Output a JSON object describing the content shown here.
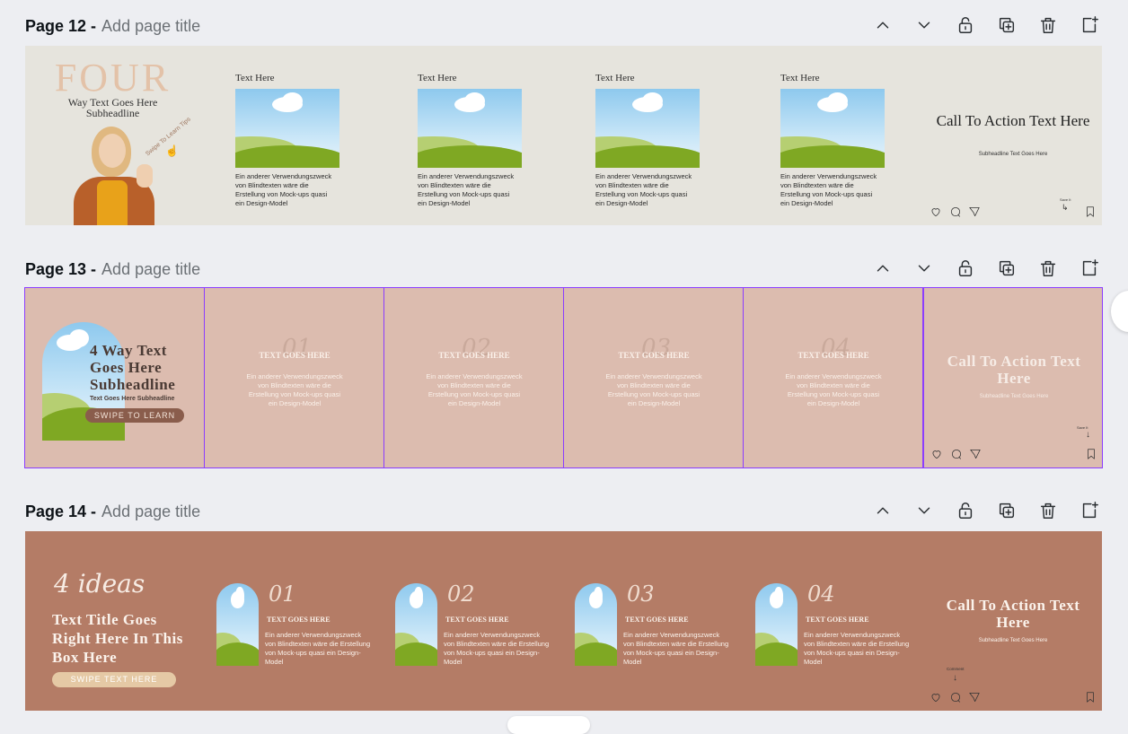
{
  "pages": [
    {
      "number_label": "Page 12 -",
      "title_placeholder": "Add page title"
    },
    {
      "number_label": "Page 13 -",
      "title_placeholder": "Add page title"
    },
    {
      "number_label": "Page 14 -",
      "title_placeholder": "Add page title"
    }
  ],
  "toolbar_icons": [
    "chevron-up-icon",
    "chevron-down-icon",
    "lock-icon",
    "duplicate-icon",
    "trash-icon",
    "add-page-icon"
  ],
  "page12": {
    "hero_big": "FOUR",
    "hero_sub": "Way Text Goes Here Subheadline",
    "hero_curve": "Swipe To Learn Tips",
    "cards": [
      {
        "title": "Text Here",
        "body": "Ein anderer Verwendungszweck von Blindtexten wäre die Erstellung von Mock-ups quasi ein Design-Model"
      },
      {
        "title": "Text Here",
        "body": "Ein anderer Verwendungszweck von Blindtexten wäre die Erstellung von Mock-ups quasi ein Design-Model"
      },
      {
        "title": "Text Here",
        "body": "Ein anderer Verwendungszweck von Blindtexten wäre die Erstellung von Mock-ups quasi ein Design-Model"
      },
      {
        "title": "Text Here",
        "body": "Ein anderer Verwendungszweck von Blindtexten wäre die Erstellung von Mock-ups quasi ein Design-Model"
      }
    ],
    "cta": "Call To Action Text Here",
    "cta_sub": "Subheadline Text Goes Here",
    "save_label": "Save It"
  },
  "page13": {
    "hero_title": "4 Way Text Goes Here Subheadline",
    "hero_sub": "Text Goes Here Subheadline",
    "hero_button": "SWIPE TO LEARN",
    "slides": [
      {
        "num": "01",
        "title": "TEXT GOES HERE",
        "body": "Ein anderer Verwendungszweck von Blindtexten wäre die Erstellung von Mock-ups quasi ein Design-Model"
      },
      {
        "num": "02",
        "title": "TEXT GOES HERE",
        "body": "Ein anderer Verwendungszweck von Blindtexten wäre die Erstellung von Mock-ups quasi ein Design-Model"
      },
      {
        "num": "03",
        "title": "TEXT GOES HERE",
        "body": "Ein anderer Verwendungszweck von Blindtexten wäre die Erstellung von Mock-ups quasi ein Design-Model"
      },
      {
        "num": "04",
        "title": "TEXT GOES HERE",
        "body": "Ein anderer Verwendungszweck von Blindtexten wäre die Erstellung von Mock-ups quasi ein Design-Model"
      }
    ],
    "cta": "Call To Action Text Here",
    "cta_sub": "Subheadline Text Goes Here",
    "save_label": "Save It"
  },
  "page14": {
    "script": "4 ideas",
    "hero_title": "Text Title Goes Right Here In This Box Here",
    "hero_button": "SWIPE TEXT HERE",
    "cards": [
      {
        "num": "01",
        "title": "TEXT GOES HERE",
        "body": "Ein anderer Verwendungszweck von Blindtexten wäre die Erstellung von Mock-ups quasi ein Design-Model"
      },
      {
        "num": "02",
        "title": "TEXT GOES HERE",
        "body": "Ein anderer Verwendungszweck von Blindtexten wäre die Erstellung von Mock-ups quasi ein Design-Model"
      },
      {
        "num": "03",
        "title": "TEXT GOES HERE",
        "body": "Ein anderer Verwendungszweck von Blindtexten wäre die Erstellung von Mock-ups quasi ein Design-Model"
      },
      {
        "num": "04",
        "title": "TEXT GOES HERE",
        "body": "Ein anderer Verwendungszweck von Blindtexten wäre die Erstellung von Mock-ups quasi ein Design-Model"
      }
    ],
    "cta": "Call To Action Text Here",
    "cta_sub": "Subheadline Text Goes Here",
    "comment_label": "Comment"
  },
  "colors": {
    "canvas_bg": "#edeef2",
    "page12_bg": "#e6e4dd",
    "page13_bg": "#dcbcaf",
    "page14_bg": "#b47c66",
    "selection": "#8b3dff"
  }
}
